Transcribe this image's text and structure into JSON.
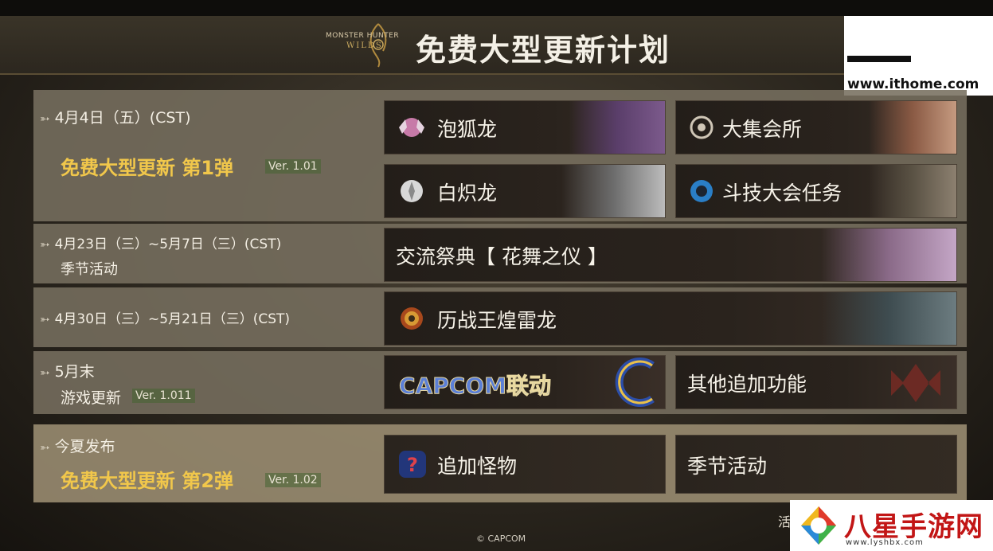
{
  "header": {
    "logo_line1": "MONSTER HUNTER",
    "logo_line2": "WILDS",
    "title": "免费大型更新计划"
  },
  "watermark_top": "www.ithome.com",
  "schedule": [
    {
      "date": "4月4日（五）(CST)",
      "title": "免费大型更新 第1弹",
      "version": "Ver. 1.01",
      "items": [
        {
          "label": "泡狐龙",
          "icon": "mizutsune-icon"
        },
        {
          "label": "大集会所",
          "icon": "gathering-hub-icon"
        },
        {
          "label": "白炽龙",
          "icon": "arkveld-icon"
        },
        {
          "label": "斗技大会任务",
          "icon": "arena-quest-icon"
        }
      ]
    },
    {
      "date": "4月23日（三）~5月7日（三）(CST)",
      "subtitle": "季节活动",
      "items": [
        {
          "label": "交流祭典【 花舞之仪 】"
        }
      ]
    },
    {
      "date": "4月30日（三）~5月21日（三）(CST)",
      "items": [
        {
          "label": "历战王煌雷龙",
          "icon": "tempered-monster-icon"
        }
      ]
    },
    {
      "date": "5月末",
      "subtitle": "游戏更新",
      "version": "Ver. 1.011",
      "items": [
        {
          "label": "CAPCOM联动",
          "icon": "capcom-logo-icon"
        },
        {
          "label": "其他追加功能"
        }
      ]
    },
    {
      "date": "今夏发布",
      "title": "免费大型更新 第2弹",
      "version": "Ver. 1.02",
      "items": [
        {
          "label": "追加怪物",
          "icon": "unknown-monster-icon"
        },
        {
          "label": "季节活动"
        }
      ]
    }
  ],
  "footer": {
    "copyright": "© CAPCOM",
    "corner_text": "活",
    "watermark_big": "八星手游网",
    "watermark_small": "www.lyshbx.com"
  }
}
